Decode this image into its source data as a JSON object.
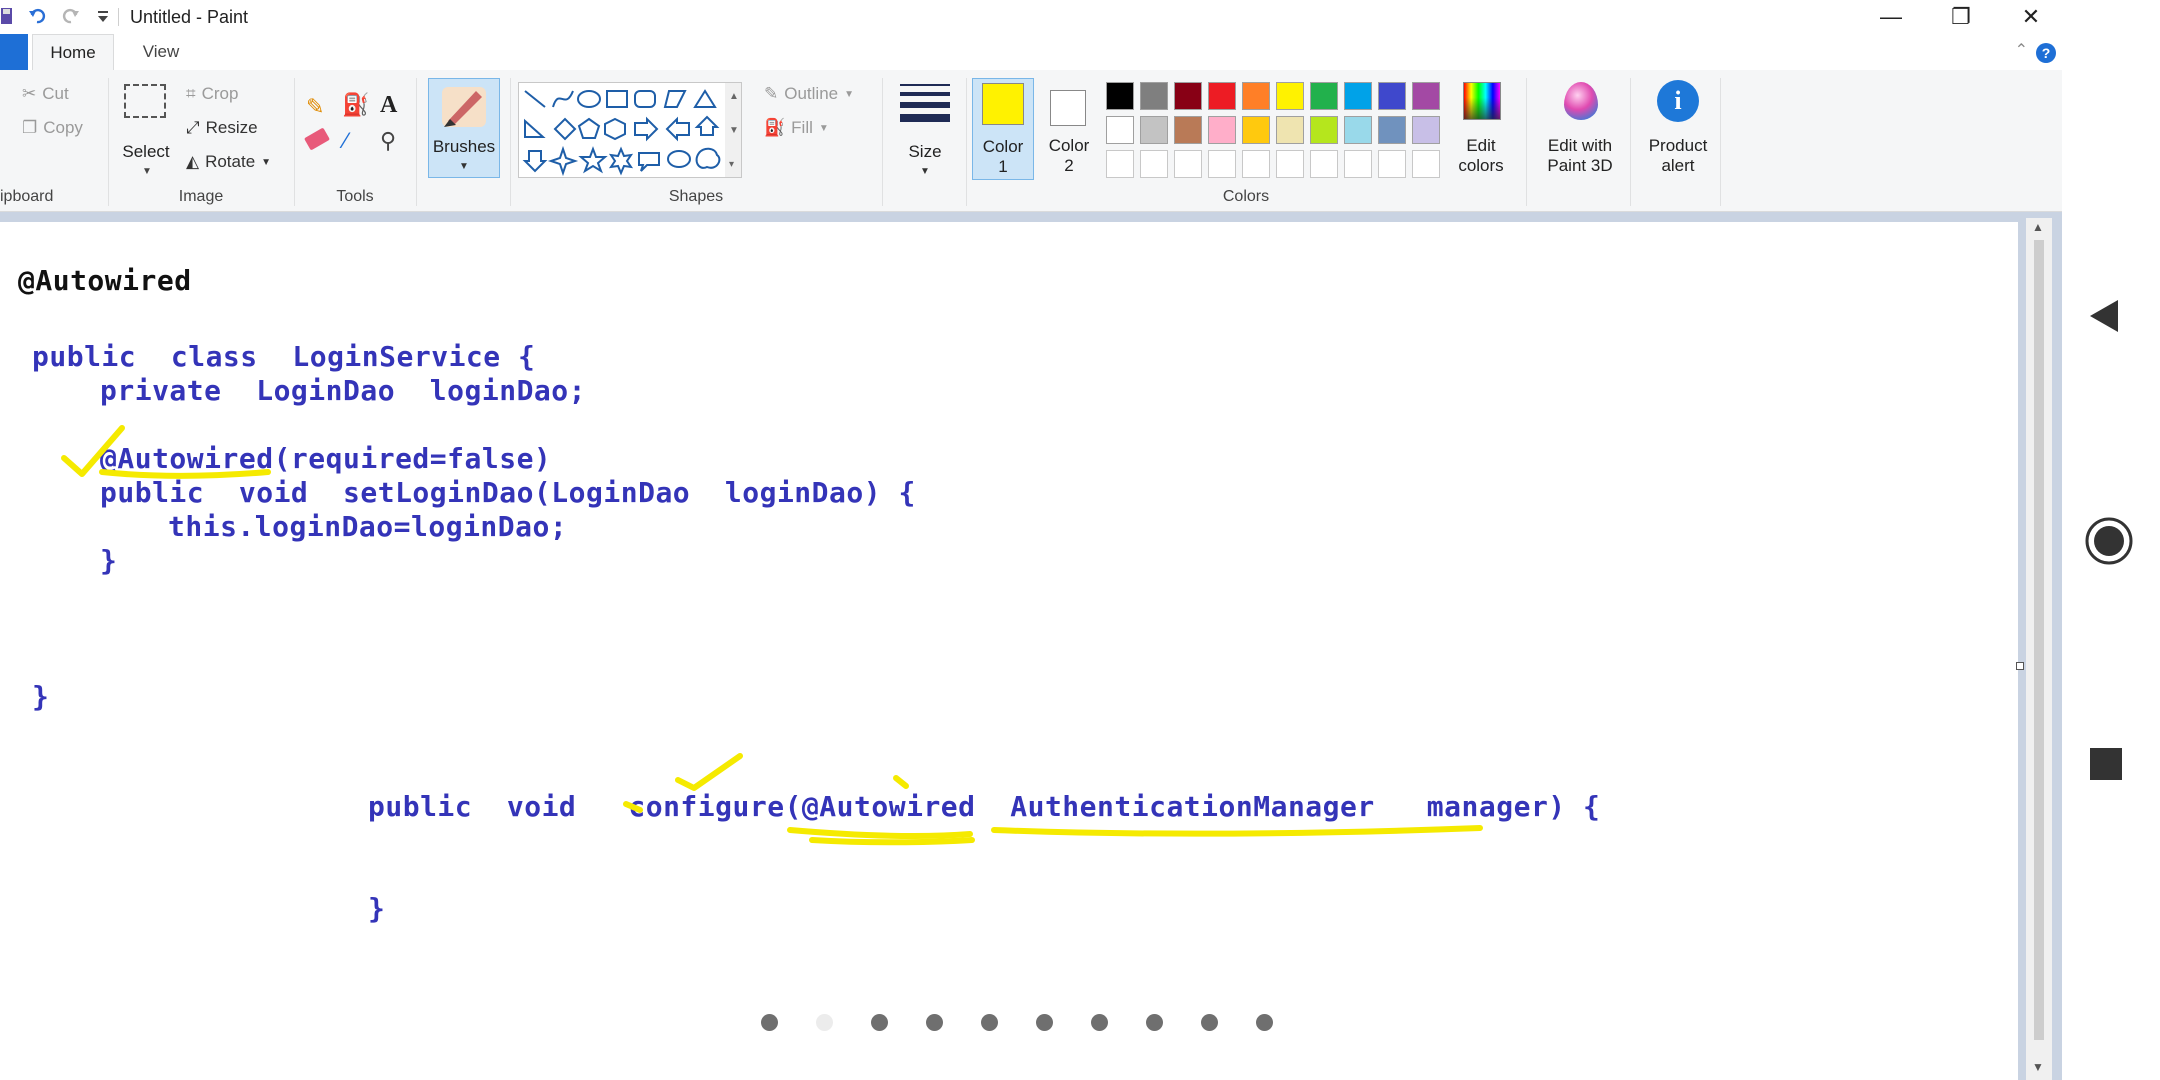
{
  "window": {
    "title": "Untitled - Paint",
    "minimize": "—",
    "restore": "❐",
    "close": "✕"
  },
  "tabs": {
    "home": "Home",
    "view": "View"
  },
  "help": "?",
  "clipboard": {
    "cut": "Cut",
    "copy": "Copy",
    "group": "ipboard"
  },
  "image": {
    "select": "Select",
    "crop": "Crop",
    "resize": "Resize",
    "rotate": "Rotate",
    "group": "Image"
  },
  "tools": {
    "group": "Tools"
  },
  "brushes": {
    "label": "Brushes"
  },
  "shapes": {
    "outline": "Outline",
    "fill": "Fill",
    "group": "Shapes"
  },
  "size": {
    "label": "Size"
  },
  "colors": {
    "color1": "Color",
    "color1_num": "1",
    "color2": "Color",
    "color2_num": "2",
    "group": "Colors",
    "edit_line1": "Edit",
    "edit_line2": "colors",
    "palette_row1": [
      "#000000",
      "#7f7f7f",
      "#880015",
      "#ed1c24",
      "#ff7f27",
      "#fff200",
      "#22b14c",
      "#00a2e8",
      "#3f48cc",
      "#a349a4"
    ],
    "palette_row2": [
      "#ffffff",
      "#c3c3c3",
      "#b97a57",
      "#ffaec9",
      "#ffc90e",
      "#efe4b0",
      "#b5e61d",
      "#99d9ea",
      "#7092be",
      "#c8bfe7"
    ],
    "primary_color": "#fff200"
  },
  "paint3d": {
    "line1": "Edit with",
    "line2": "Paint 3D"
  },
  "product": {
    "line1": "Product",
    "line2": "alert"
  },
  "code": {
    "heading": "@Autowired",
    "l1": "public  class  LoginService {",
    "l2": "private  LoginDao  loginDao;",
    "l3": "@Autowired(required=false)",
    "l4": "public  void  setLoginDao(LoginDao  loginDao) {",
    "l5": "this.loginDao=loginDao;",
    "l6": "}",
    "l7": "}",
    "l8": "public  void   configure(@Autowired  AuthenticationManager   manager) {",
    "l9": "}"
  },
  "pager": {
    "count": 10,
    "active_index": 1
  }
}
